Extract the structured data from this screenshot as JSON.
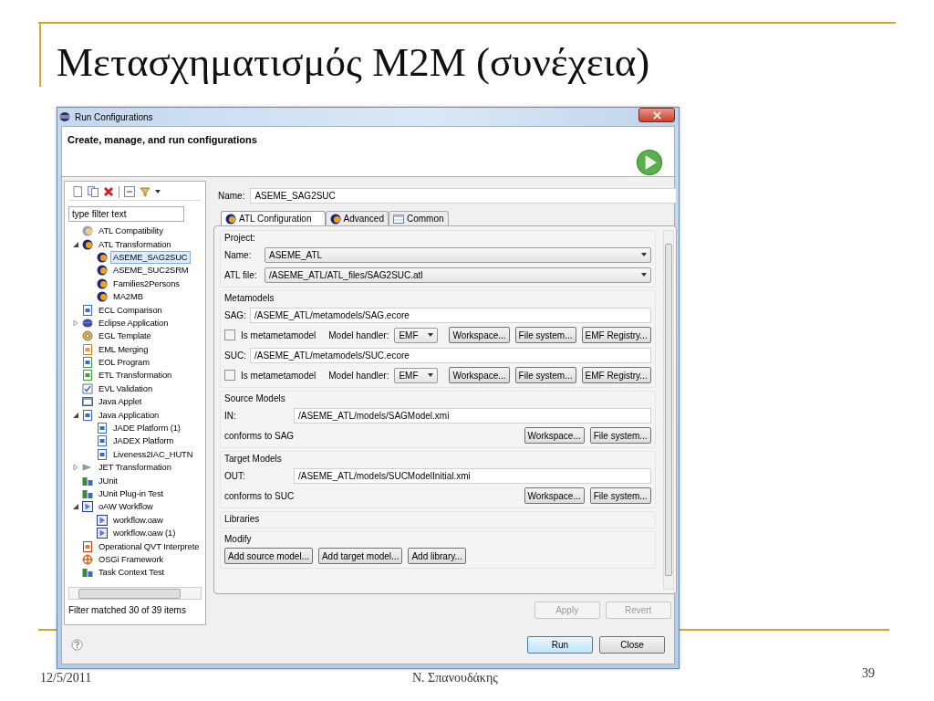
{
  "slide": {
    "title": "Μετασχηματισμός M2M (συνέχεια)",
    "footer": {
      "date": "12/5/2011",
      "author": "Ν. Σπανουδάκης",
      "page": "39"
    }
  },
  "dialog": {
    "title": "Run Configurations",
    "header": "Create, manage, and run configurations",
    "sidebar": {
      "filter_placeholder": "type filter text",
      "status": "Filter matched 30 of 39 items",
      "tree": [
        {
          "label": "ATL Compatibility",
          "kind": "atl-grey",
          "selected": false
        },
        {
          "label": "ATL Transformation",
          "kind": "atl",
          "selected": false,
          "expanded": true,
          "children": [
            {
              "label": "ASEME_SAG2SUC",
              "kind": "atl",
              "selected": true
            },
            {
              "label": "ASEME_SUC2SRM",
              "kind": "atl",
              "selected": false
            },
            {
              "label": "Families2Persons",
              "kind": "atl",
              "selected": false
            },
            {
              "label": "MA2MB",
              "kind": "atl",
              "selected": false
            }
          ]
        },
        {
          "label": "ECL Comparison",
          "kind": "ecl",
          "selected": false
        },
        {
          "label": "Eclipse Application",
          "kind": "eclipse",
          "selected": false,
          "expanded": false
        },
        {
          "label": "EGL Template",
          "kind": "egl",
          "selected": false
        },
        {
          "label": "EML Merging",
          "kind": "eml",
          "selected": false
        },
        {
          "label": "EOL Program",
          "kind": "eol",
          "selected": false
        },
        {
          "label": "ETL Transformation",
          "kind": "etl",
          "selected": false
        },
        {
          "label": "EVL Validation",
          "kind": "evl",
          "selected": false
        },
        {
          "label": "Java Applet",
          "kind": "applet",
          "selected": false
        },
        {
          "label": "Java Application",
          "kind": "java",
          "selected": false,
          "expanded": true,
          "children": [
            {
              "label": "JADE Platform (1)",
              "kind": "java",
              "selected": false
            },
            {
              "label": "JADEX Platform",
              "kind": "java",
              "selected": false
            },
            {
              "label": "Liveness2IAC_HUTN",
              "kind": "java",
              "selected": false
            }
          ]
        },
        {
          "label": "JET Transformation",
          "kind": "jet",
          "selected": false,
          "expanded": false
        },
        {
          "label": "JUnit",
          "kind": "junit",
          "selected": false
        },
        {
          "label": "JUnit Plug-in Test",
          "kind": "junit",
          "selected": false
        },
        {
          "label": "oAW Workflow",
          "kind": "oaw",
          "selected": false,
          "expanded": true,
          "children": [
            {
              "label": "workflow.oaw",
              "kind": "oaw",
              "selected": false
            },
            {
              "label": "workflow.oaw (1)",
              "kind": "oaw",
              "selected": false
            }
          ]
        },
        {
          "label": "Operational QVT Interprete",
          "kind": "qvt",
          "selected": false
        },
        {
          "label": "OSGi Framework",
          "kind": "osgi",
          "selected": false
        },
        {
          "label": "Task Context Test",
          "kind": "junit",
          "selected": false
        }
      ]
    },
    "editor": {
      "name_label": "Name:",
      "name": "ASEME_SAG2SUC",
      "tabs": [
        {
          "label": "ATL Configuration",
          "kind": "atl",
          "selected": true
        },
        {
          "label": "Advanced",
          "kind": "atl",
          "selected": false
        },
        {
          "label": "Common",
          "kind": "common",
          "selected": false
        }
      ],
      "project": {
        "title": "Project:",
        "fields": [
          {
            "label": "Name:",
            "value": "ASEME_ATL"
          },
          {
            "label": "ATL file:",
            "value": "/ASEME_ATL/ATL_files/SAG2SUC.atl"
          }
        ]
      },
      "metamodels": {
        "title": "Metamodels",
        "items": [
          {
            "label": "SAG:",
            "path": "/ASEME_ATL/metamodels/SAG.ecore",
            "checkbox": "Is metametamodel",
            "checked": false,
            "handler_label": "Model handler:",
            "handler": "EMF",
            "buttons": [
              "Workspace...",
              "File system...",
              "EMF Registry..."
            ]
          },
          {
            "label": "SUC:",
            "path": "/ASEME_ATL/metamodels/SUC.ecore",
            "checkbox": "Is metametamodel",
            "checked": false,
            "handler_label": "Model handler:",
            "handler": "EMF",
            "buttons": [
              "Workspace...",
              "File system...",
              "EMF Registry..."
            ]
          }
        ]
      },
      "models": [
        {
          "title": "Source Models",
          "label": "IN:",
          "path": "/ASEME_ATL/models/SAGModel.xmi",
          "conforms": "conforms to SAG",
          "buttons": [
            "Workspace...",
            "File system..."
          ]
        },
        {
          "title": "Target Models",
          "label": "OUT:",
          "path": "/ASEME_ATL/models/SUCModelInitial.xmi",
          "conforms": "conforms to SUC",
          "buttons": [
            "Workspace...",
            "File system..."
          ]
        }
      ],
      "libraries": {
        "title": "Libraries"
      },
      "modify": {
        "title": "Modify",
        "buttons": [
          "Add source model...",
          "Add target model...",
          "Add library..."
        ]
      },
      "actions": [
        {
          "label": "Apply",
          "disabled": true
        },
        {
          "label": "Revert",
          "disabled": true
        }
      ]
    },
    "buttons": [
      {
        "label": "Run",
        "default": true
      },
      {
        "label": "Close",
        "default": false
      }
    ]
  }
}
